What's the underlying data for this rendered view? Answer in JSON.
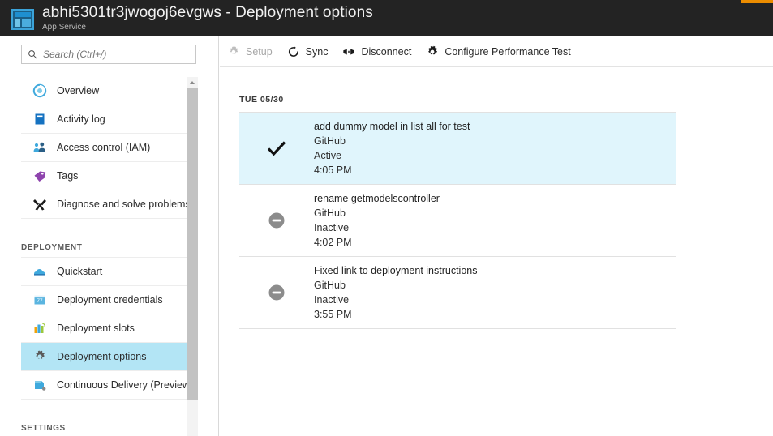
{
  "header": {
    "title": "abhi5301tr3jwogoj6evgws - Deployment options",
    "subtitle": "App Service",
    "icon": "app-service-icon"
  },
  "sidebar": {
    "search": {
      "placeholder": "Search (Ctrl+/)",
      "value": "",
      "icon": "search-icon"
    },
    "items": [
      {
        "label": "Overview",
        "icon": "overview-icon",
        "selected": false
      },
      {
        "label": "Activity log",
        "icon": "activity-log-icon",
        "selected": false
      },
      {
        "label": "Access control (IAM)",
        "icon": "access-control-icon",
        "selected": false
      },
      {
        "label": "Tags",
        "icon": "tags-icon",
        "selected": false
      },
      {
        "label": "Diagnose and solve problems",
        "icon": "diagnose-icon",
        "selected": false
      }
    ],
    "section_deployment": "DEPLOYMENT",
    "deployment_items": [
      {
        "label": "Quickstart",
        "icon": "quickstart-icon",
        "selected": false
      },
      {
        "label": "Deployment credentials",
        "icon": "credentials-icon",
        "selected": false
      },
      {
        "label": "Deployment slots",
        "icon": "slots-icon",
        "selected": false
      },
      {
        "label": "Deployment options",
        "icon": "gear-icon",
        "selected": true
      },
      {
        "label": "Continuous Delivery (Preview)",
        "icon": "continuous-delivery-icon",
        "selected": false
      }
    ],
    "section_settings": "SETTINGS",
    "scrollbar": {
      "up_icon": "scroll-up-arrow-icon"
    }
  },
  "toolbar": {
    "buttons": [
      {
        "label": "Setup",
        "icon": "gear-icon",
        "disabled": true
      },
      {
        "label": "Sync",
        "icon": "sync-refresh-icon",
        "disabled": false
      },
      {
        "label": "Disconnect",
        "icon": "disconnect-icon",
        "disabled": false
      },
      {
        "label": "Configure Performance Test",
        "icon": "gear-icon",
        "disabled": false
      }
    ]
  },
  "main": {
    "date_group": "TUE 05/30",
    "deployments": [
      {
        "message": "add dummy model in list all for test",
        "source": "GitHub",
        "status": "Active",
        "time": "4:05 PM",
        "status_icon": "checkmark-icon",
        "highlighted": true
      },
      {
        "message": "rename getmodelscontroller",
        "source": "GitHub",
        "status": "Inactive",
        "time": "4:02 PM",
        "status_icon": "minus-circle-icon",
        "highlighted": false
      },
      {
        "message": "Fixed link to deployment instructions",
        "source": "GitHub",
        "status": "Inactive",
        "time": "3:55 PM",
        "status_icon": "minus-circle-icon",
        "highlighted": false
      }
    ]
  },
  "colors": {
    "titlebar_bg": "#232323",
    "accent_orange": "#eb8c00",
    "selection_blue": "#b3e5f5",
    "row_highlight_blue": "#e0f5fc",
    "azure_blue": "#0078d4"
  }
}
